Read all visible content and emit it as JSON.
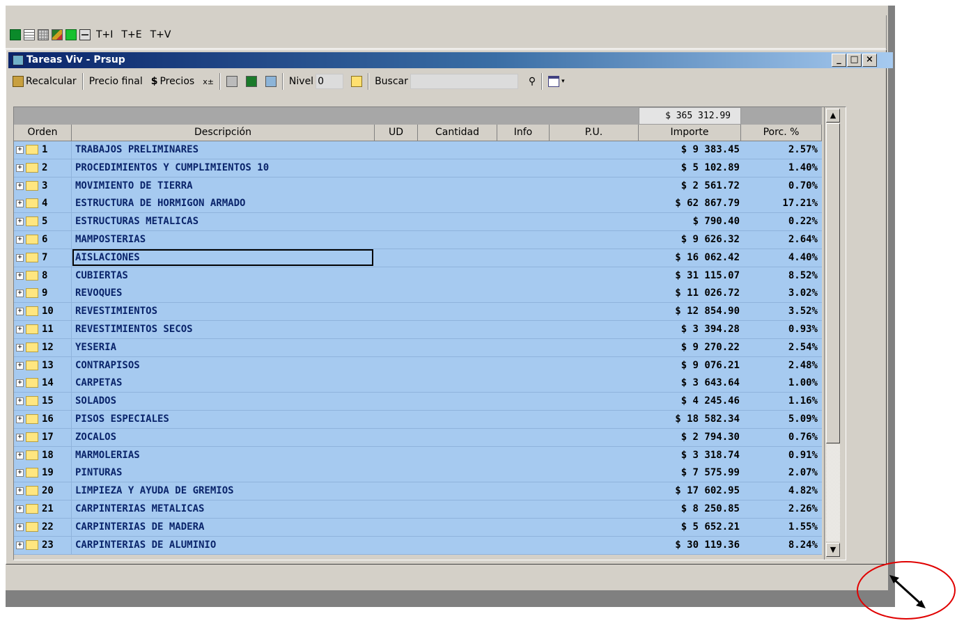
{
  "toolbar": {
    "buttons": [
      {
        "name": "form-icon"
      },
      {
        "name": "document-icon"
      },
      {
        "name": "grid-icon"
      },
      {
        "name": "chart-icon"
      },
      {
        "name": "pause-icon"
      },
      {
        "name": "network-icon"
      }
    ],
    "text_buttons": [
      "T+I",
      "T+E",
      "T+V"
    ]
  },
  "window": {
    "title": "Tareas Viv - Prsup",
    "controls": {
      "minimize": "_",
      "maximize": "□",
      "close": "×"
    }
  },
  "subtoolbar": {
    "recalcular": "Recalcular",
    "precio_final": "Precio final",
    "precios": "Precios",
    "nivel_label": "Nivel",
    "nivel_value": "0",
    "buscar_label": "Buscar",
    "buscar_value": ""
  },
  "grid": {
    "total": "$ 365 312.99",
    "columns": [
      "Orden",
      "Descripción",
      "UD",
      "Cantidad",
      "Info",
      "P.U.",
      "Importe",
      "Porc. %"
    ],
    "rows": [
      {
        "orden": "1",
        "descripcion": "TRABAJOS PRELIMINARES",
        "importe": "$ 9 383.45",
        "porc": "2.57%"
      },
      {
        "orden": "2",
        "descripcion": "PROCEDIMIENTOS Y CUMPLIMIENTOS 10",
        "importe": "$ 5 102.89",
        "porc": "1.40%"
      },
      {
        "orden": "3",
        "descripcion": "MOVIMIENTO DE TIERRA",
        "importe": "$ 2 561.72",
        "porc": "0.70%"
      },
      {
        "orden": "4",
        "descripcion": "ESTRUCTURA DE HORMIGON ARMADO",
        "importe": "$ 62 867.79",
        "porc": "17.21%"
      },
      {
        "orden": "5",
        "descripcion": "ESTRUCTURAS METALICAS",
        "importe": "$ 790.40",
        "porc": "0.22%"
      },
      {
        "orden": "6",
        "descripcion": "MAMPOSTERIAS",
        "importe": "$ 9 626.32",
        "porc": "2.64%"
      },
      {
        "orden": "7",
        "descripcion": "AISLACIONES",
        "importe": "$ 16 062.42",
        "porc": "4.40%",
        "selected": true
      },
      {
        "orden": "8",
        "descripcion": "CUBIERTAS",
        "importe": "$ 31 115.07",
        "porc": "8.52%"
      },
      {
        "orden": "9",
        "descripcion": "REVOQUES",
        "importe": "$ 11 026.72",
        "porc": "3.02%"
      },
      {
        "orden": "10",
        "descripcion": "REVESTIMIENTOS",
        "importe": "$ 12 854.90",
        "porc": "3.52%"
      },
      {
        "orden": "11",
        "descripcion": "REVESTIMIENTOS SECOS",
        "importe": "$ 3 394.28",
        "porc": "0.93%"
      },
      {
        "orden": "12",
        "descripcion": "YESERIA",
        "importe": "$ 9 270.22",
        "porc": "2.54%"
      },
      {
        "orden": "13",
        "descripcion": "CONTRAPISOS",
        "importe": "$ 9 076.21",
        "porc": "2.48%"
      },
      {
        "orden": "14",
        "descripcion": "CARPETAS",
        "importe": "$ 3 643.64",
        "porc": "1.00%"
      },
      {
        "orden": "15",
        "descripcion": "SOLADOS",
        "importe": "$ 4 245.46",
        "porc": "1.16%"
      },
      {
        "orden": "16",
        "descripcion": "PISOS ESPECIALES",
        "importe": "$ 18 582.34",
        "porc": "5.09%"
      },
      {
        "orden": "17",
        "descripcion": "ZOCALOS",
        "importe": "$ 2 794.30",
        "porc": "0.76%"
      },
      {
        "orden": "18",
        "descripcion": "MARMOLERIAS",
        "importe": "$ 3 318.74",
        "porc": "0.91%"
      },
      {
        "orden": "19",
        "descripcion": "PINTURAS",
        "importe": "$ 7 575.99",
        "porc": "2.07%"
      },
      {
        "orden": "20",
        "descripcion": "LIMPIEZA Y AYUDA DE GREMIOS",
        "importe": "$ 17 602.95",
        "porc": "4.82%"
      },
      {
        "orden": "21",
        "descripcion": "CARPINTERIAS METALICAS",
        "importe": "$ 8 250.85",
        "porc": "2.26%"
      },
      {
        "orden": "22",
        "descripcion": "CARPINTERIAS DE MADERA",
        "importe": "$ 5 652.21",
        "porc": "1.55%"
      },
      {
        "orden": "23",
        "descripcion": "CARPINTERIAS DE ALUMINIO",
        "importe": "$ 30 119.36",
        "porc": "8.24%"
      }
    ]
  },
  "colors": {
    "row_bg": "#a6caf0",
    "title_gradient_start": "#0a246a",
    "annotation_red": "#e00000"
  }
}
